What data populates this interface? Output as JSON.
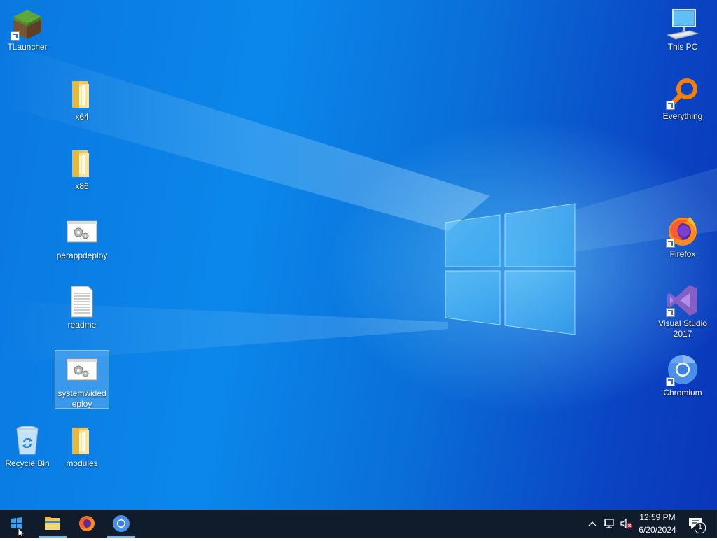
{
  "desktop": {
    "icons": [
      {
        "label": "TLauncher",
        "icon": "minecraft-grass-block-icon",
        "shortcut": true
      },
      {
        "label": "x64",
        "icon": "folder-icon"
      },
      {
        "label": "x86",
        "icon": "folder-icon"
      },
      {
        "label": "perappdeploy",
        "icon": "config-settings-file-icon"
      },
      {
        "label": "readme",
        "icon": "text-document-icon"
      },
      {
        "label": "systemwidedeploy",
        "icon": "config-settings-file-icon",
        "selected": true
      },
      {
        "label": "Recycle Bin",
        "icon": "recycle-bin-icon"
      },
      {
        "label": "modules",
        "icon": "folder-icon"
      },
      {
        "label": "This PC",
        "icon": "computer-monitor-icon"
      },
      {
        "label": "Everything",
        "icon": "everything-search-icon",
        "shortcut": true
      },
      {
        "label": "Firefox",
        "icon": "firefox-icon",
        "shortcut": true
      },
      {
        "label": "Visual Studio 2017",
        "icon": "visual-studio-icon",
        "shortcut": true
      },
      {
        "label": "Chromium",
        "icon": "chromium-icon",
        "shortcut": true
      }
    ]
  },
  "taskbar": {
    "start_icon": "windows-logo-icon",
    "pinned": [
      {
        "name": "File Explorer",
        "icon": "file-explorer-icon",
        "active": true
      },
      {
        "name": "Firefox",
        "icon": "firefox-icon",
        "active": false
      },
      {
        "name": "Chromium",
        "icon": "chromium-icon",
        "active": true
      }
    ],
    "tray": {
      "time": "12:59 PM",
      "date": "6/20/2024",
      "notification_count": "1"
    }
  },
  "colors": {
    "taskbar_bg": "#101c2c",
    "active_underline": "#76b9ed",
    "desktop_blue": "#0a78e0"
  }
}
